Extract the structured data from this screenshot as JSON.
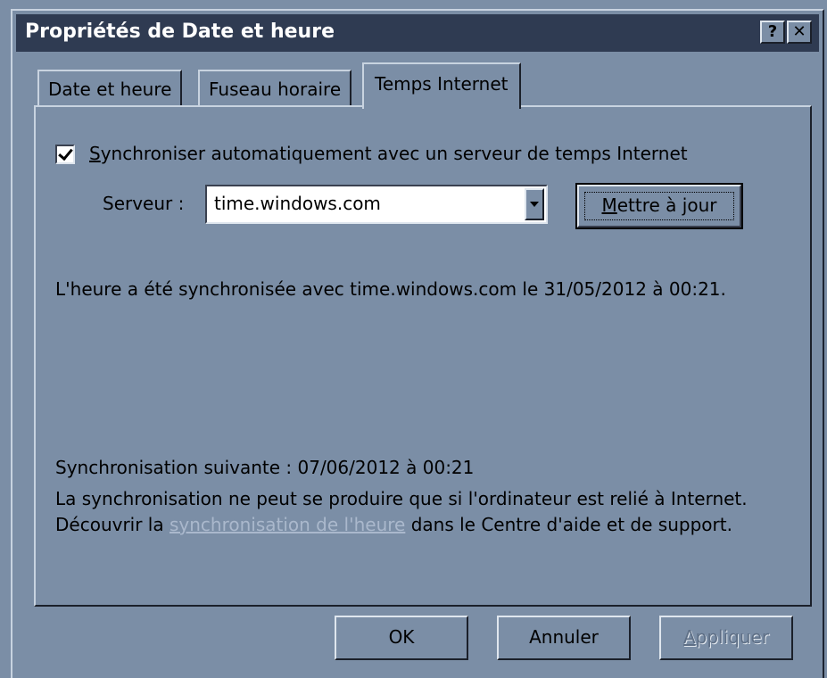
{
  "window": {
    "title": "Propriétés de Date et heure",
    "help_glyph": "?",
    "close_glyph": "✕"
  },
  "tabs": [
    {
      "label": "Date et heure",
      "active": false
    },
    {
      "label": "Fuseau horaire",
      "active": false
    },
    {
      "label": "Temps Internet",
      "active": true
    }
  ],
  "internet_time": {
    "auto_sync": {
      "checked": true,
      "label_first": "S",
      "label_rest": "ynchroniser automatiquement avec un serveur de temps Internet"
    },
    "server": {
      "label": "Serveur :",
      "value": "time.windows.com"
    },
    "update_button": {
      "label_first": "M",
      "label_rest": "ettre à jour"
    },
    "last_sync": "L'heure a été synchronisée avec time.windows.com le 31/05/2012 à 00:21.",
    "next_sync": "Synchronisation suivante : 07/06/2012 à 00:21",
    "note_before": "La synchronisation ne peut se produire que si l'ordinateur est relié à Internet. Découvrir la ",
    "note_link": "synchronisation de l'heure",
    "note_after": " dans le Centre d'aide et de support."
  },
  "buttons": {
    "ok": "OK",
    "cancel": "Annuler",
    "apply_first": "A",
    "apply_rest": "ppliquer",
    "apply_enabled": false
  },
  "colors": {
    "dialog_face": "#7b8ea6",
    "titlebar": "#2f3b52",
    "link": "#aab8cc"
  }
}
